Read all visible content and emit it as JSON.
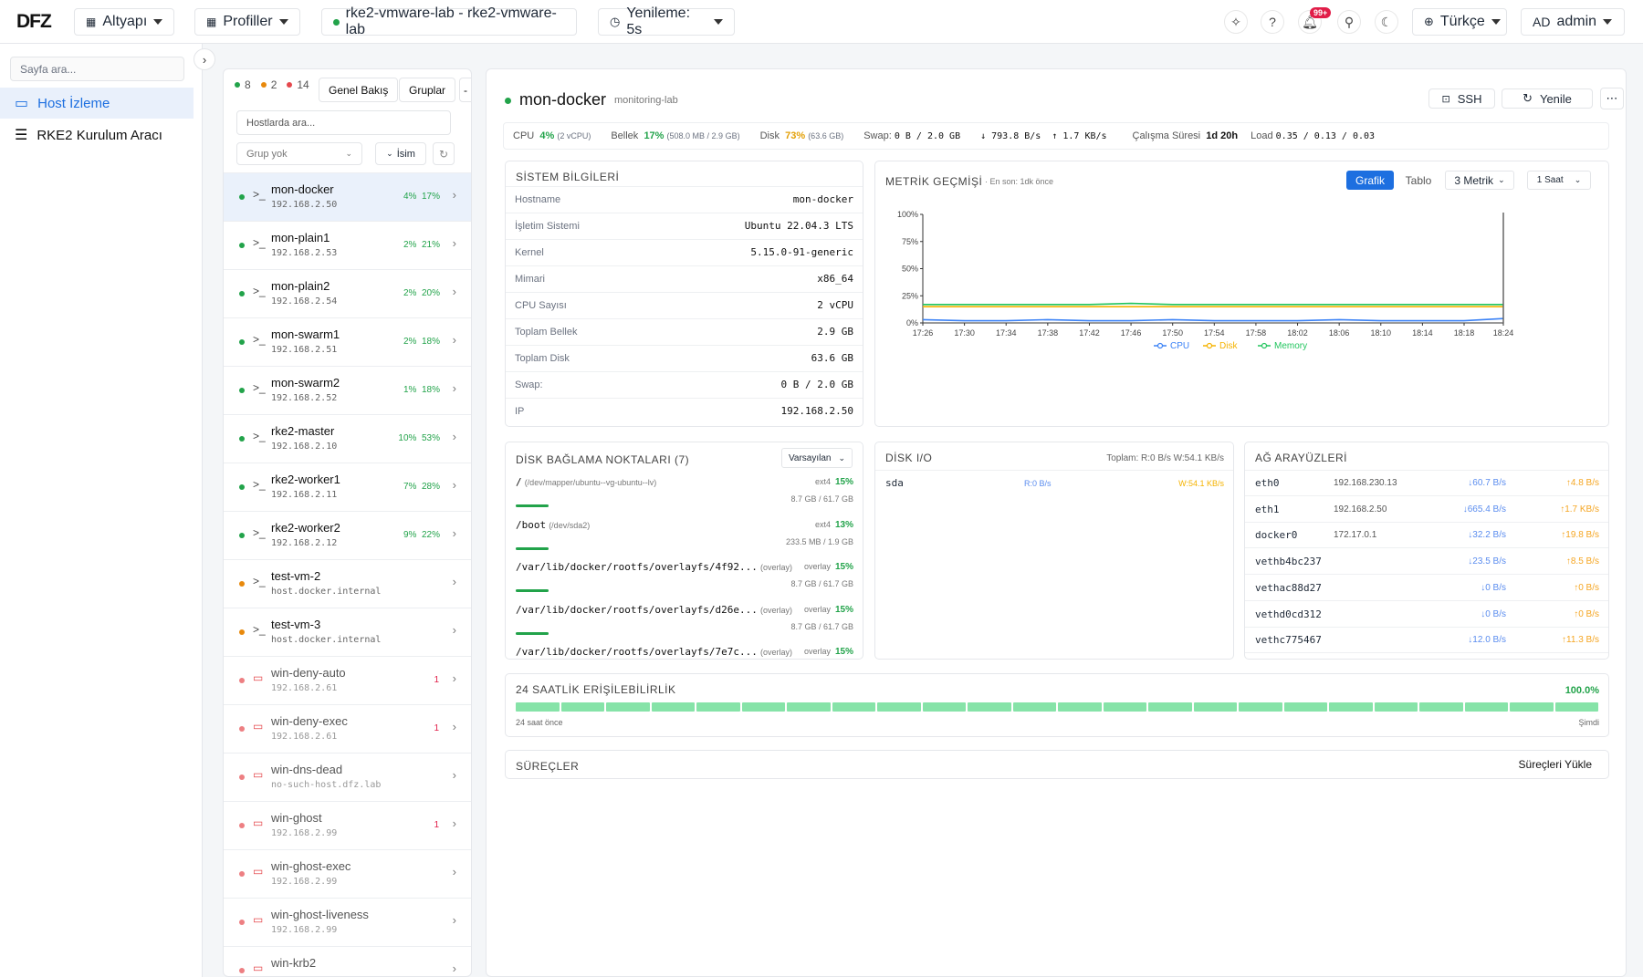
{
  "app": {
    "logo": "DFZ"
  },
  "topbar": {
    "infra": "Altyapı",
    "profiles": "Profiller",
    "context": "rke2-vmware-lab - rke2-vmware-lab",
    "refresh": "Yenileme:  5s",
    "notif_badge": "99+",
    "language": "Türkçe",
    "user_initials": "AD",
    "user_name": "admin"
  },
  "sidebar": {
    "search_placeholder": "Sayfa ara...",
    "items": [
      {
        "label": "Host İzleme",
        "icon": "monitor-icon",
        "active": true
      },
      {
        "label": "RKE2 Kurulum Aracı",
        "icon": "server-icon",
        "active": false
      }
    ]
  },
  "hostlist": {
    "counts": {
      "green": "8",
      "orange": "2",
      "red": "14"
    },
    "tab_overview": "Genel Bakış",
    "tab_groups": "Gruplar",
    "search_placeholder": "Hostlarda ara...",
    "group_select": "Grup yok",
    "sort": "İsim",
    "hosts": [
      {
        "name": "mon-docker",
        "ip": "192.168.2.50",
        "cpu": "4%",
        "mem": "17%",
        "status": "green",
        "selected": true
      },
      {
        "name": "mon-plain1",
        "ip": "192.168.2.53",
        "cpu": "2%",
        "mem": "21%",
        "status": "green"
      },
      {
        "name": "mon-plain2",
        "ip": "192.168.2.54",
        "cpu": "2%",
        "mem": "20%",
        "status": "green"
      },
      {
        "name": "mon-swarm1",
        "ip": "192.168.2.51",
        "cpu": "2%",
        "mem": "18%",
        "status": "green"
      },
      {
        "name": "mon-swarm2",
        "ip": "192.168.2.52",
        "cpu": "1%",
        "mem": "18%",
        "status": "green"
      },
      {
        "name": "rke2-master",
        "ip": "192.168.2.10",
        "cpu": "10%",
        "mem": "53%",
        "status": "green"
      },
      {
        "name": "rke2-worker1",
        "ip": "192.168.2.11",
        "cpu": "7%",
        "mem": "28%",
        "status": "green"
      },
      {
        "name": "rke2-worker2",
        "ip": "192.168.2.12",
        "cpu": "9%",
        "mem": "22%",
        "status": "green"
      },
      {
        "name": "test-vm-2",
        "ip": "host.docker.internal",
        "cpu": "",
        "mem": "",
        "status": "orange"
      },
      {
        "name": "test-vm-3",
        "ip": "host.docker.internal",
        "cpu": "",
        "mem": "",
        "status": "orange"
      },
      {
        "name": "win-deny-auto",
        "ip": "192.168.2.61",
        "alerts": "1",
        "status": "red"
      },
      {
        "name": "win-deny-exec",
        "ip": "192.168.2.61",
        "alerts": "1",
        "status": "red"
      },
      {
        "name": "win-dns-dead",
        "ip": "no-such-host.dfz.lab",
        "alerts": "",
        "status": "red"
      },
      {
        "name": "win-ghost",
        "ip": "192.168.2.99",
        "alerts": "1",
        "status": "red"
      },
      {
        "name": "win-ghost-exec",
        "ip": "192.168.2.99",
        "alerts": "",
        "status": "red"
      },
      {
        "name": "win-ghost-liveness",
        "ip": "192.168.2.99",
        "alerts": "",
        "status": "red"
      },
      {
        "name": "win-krb2",
        "ip": "",
        "alerts": "",
        "status": "red"
      }
    ]
  },
  "host": {
    "name": "mon-docker",
    "profile": "monitoring-lab",
    "ssh": "SSH",
    "refresh": "Yenile",
    "summary": {
      "cpu_label": "CPU",
      "cpu_val": "4%",
      "cpu_sub": "(2 vCPU)",
      "mem_label": "Bellek",
      "mem_val": "17%",
      "mem_sub": "(508.0 MB / 2.9 GB)",
      "disk_label": "Disk",
      "disk_val": "73%",
      "disk_sub": "(63.6 GB)",
      "swap_label": "Swap:",
      "swap_val": "0 B / 2.0 GB",
      "net_down": "↓ 793.8 B/s",
      "net_up": "↑ 1.7 KB/s",
      "uptime_label": "Çalışma Süresi",
      "uptime_val": "1d 20h",
      "load_label": "Load",
      "load_val": "0.35 / 0.13 / 0.03"
    },
    "sysinfo": {
      "title": "SİSTEM BİLGİLERİ",
      "rows": [
        {
          "k": "Hostname",
          "v": "mon-docker"
        },
        {
          "k": "İşletim Sistemi",
          "v": "Ubuntu 22.04.3 LTS"
        },
        {
          "k": "Kernel",
          "v": "5.15.0-91-generic"
        },
        {
          "k": "Mimari",
          "v": "x86_64"
        },
        {
          "k": "CPU Sayısı",
          "v": "2 vCPU"
        },
        {
          "k": "Toplam Bellek",
          "v": "2.9 GB"
        },
        {
          "k": "Toplam Disk",
          "v": "63.6 GB"
        },
        {
          "k": "Swap:",
          "v": "0 B / 2.0 GB"
        },
        {
          "k": "IP",
          "v": "192.168.2.50"
        }
      ]
    },
    "metrics": {
      "title": "METRİK GEÇMİŞİ",
      "subtitle": "· En son: 1dk önce",
      "btn_chart": "Grafik",
      "btn_table": "Tablo",
      "metric_select": "3 Metrik",
      "range_select": "1 Saat"
    },
    "mounts": {
      "title": "DİSK BAĞLAMA NOKTALARI (7)",
      "sort": "Varsayılan",
      "items": [
        {
          "path": "/",
          "dev": "(/dev/mapper/ubuntu--vg-ubuntu--lv)",
          "fs": "ext4",
          "pct": "15%",
          "usage": "8.7 GB / 61.7 GB",
          "fill": 0.15
        },
        {
          "path": "/boot",
          "dev": "(/dev/sda2)",
          "fs": "ext4",
          "pct": "13%",
          "usage": "233.5 MB / 1.9 GB",
          "fill": 0.13
        },
        {
          "path": "/var/lib/docker/rootfs/overlayfs/4f92...",
          "dev": "(overlay)",
          "fs": "overlay",
          "pct": "15%",
          "usage": "8.7 GB / 61.7 GB",
          "fill": 0.15
        },
        {
          "path": "/var/lib/docker/rootfs/overlayfs/d26e...",
          "dev": "(overlay)",
          "fs": "overlay",
          "pct": "15%",
          "usage": "8.7 GB / 61.7 GB",
          "fill": 0.15
        },
        {
          "path": "/var/lib/docker/rootfs/overlayfs/7e7c...",
          "dev": "(overlay)",
          "fs": "overlay",
          "pct": "15%",
          "usage": "8.7 GB / 61.7 GB",
          "fill": 0.15
        }
      ]
    },
    "diskio": {
      "title": "DİSK I/O",
      "total": "Toplam: R:0 B/s W:54.1 KB/s",
      "rows": [
        {
          "dev": "sda",
          "r": "R:0 B/s",
          "w": "W:54.1 KB/s"
        }
      ]
    },
    "net": {
      "title": "AĞ ARAYÜZLERİ",
      "rows": [
        {
          "name": "eth0",
          "ip": "192.168.230.13",
          "rx": "↓60.7 B/s",
          "tx": "↑4.8 B/s"
        },
        {
          "name": "eth1",
          "ip": "192.168.2.50",
          "rx": "↓665.4 B/s",
          "tx": "↑1.7 KB/s"
        },
        {
          "name": "docker0",
          "ip": "172.17.0.1",
          "rx": "↓32.2 B/s",
          "tx": "↑19.8 B/s"
        },
        {
          "name": "vethb4bc237",
          "ip": "",
          "rx": "↓23.5 B/s",
          "tx": "↑8.5 B/s"
        },
        {
          "name": "vethac88d27",
          "ip": "",
          "rx": "↓0 B/s",
          "tx": "↑0 B/s"
        },
        {
          "name": "vethd0cd312",
          "ip": "",
          "rx": "↓0 B/s",
          "tx": "↑0 B/s"
        },
        {
          "name": "vethc775467",
          "ip": "",
          "rx": "↓12.0 B/s",
          "tx": "↑11.3 B/s"
        }
      ]
    },
    "availability": {
      "title": "24 SAATLİK ERİŞİLEBİLİRLİK",
      "pct": "100.0%",
      "start": "24 saat önce",
      "end": "Şimdi",
      "segments": 24
    },
    "processes": {
      "title": "SÜREÇLER",
      "load": "Süreçleri Yükle"
    }
  },
  "colors": {
    "accent": "#1d6fe0",
    "green": "#22a34a",
    "orange": "#e8890c",
    "red": "#e5484d",
    "cpu": "#3b82f6",
    "disk": "#f5b301",
    "memory": "#22c55e"
  },
  "chart_data": {
    "type": "line",
    "title": "",
    "x": [
      "17:26",
      "17:30",
      "17:34",
      "17:38",
      "17:42",
      "17:46",
      "17:50",
      "17:54",
      "17:58",
      "18:02",
      "18:06",
      "18:10",
      "18:14",
      "18:18",
      "18:24"
    ],
    "y_ticks": [
      "100%",
      "75%",
      "50%",
      "25%",
      "0%"
    ],
    "ylim": [
      0,
      100
    ],
    "series": [
      {
        "name": "CPU",
        "color": "#3b82f6",
        "values": [
          3,
          2,
          2,
          3,
          2,
          2,
          3,
          2,
          2,
          2,
          3,
          2,
          2,
          2,
          4
        ]
      },
      {
        "name": "Disk",
        "color": "#f5b301",
        "values": [
          15,
          15,
          15,
          15,
          15,
          15,
          15,
          15,
          15,
          15,
          15,
          15,
          15,
          15,
          15
        ]
      },
      {
        "name": "Memory",
        "color": "#22c55e",
        "values": [
          17,
          17,
          17,
          17,
          17,
          18,
          17,
          17,
          17,
          17,
          17,
          17,
          17,
          17,
          17
        ]
      }
    ],
    "legend": "bottom"
  }
}
